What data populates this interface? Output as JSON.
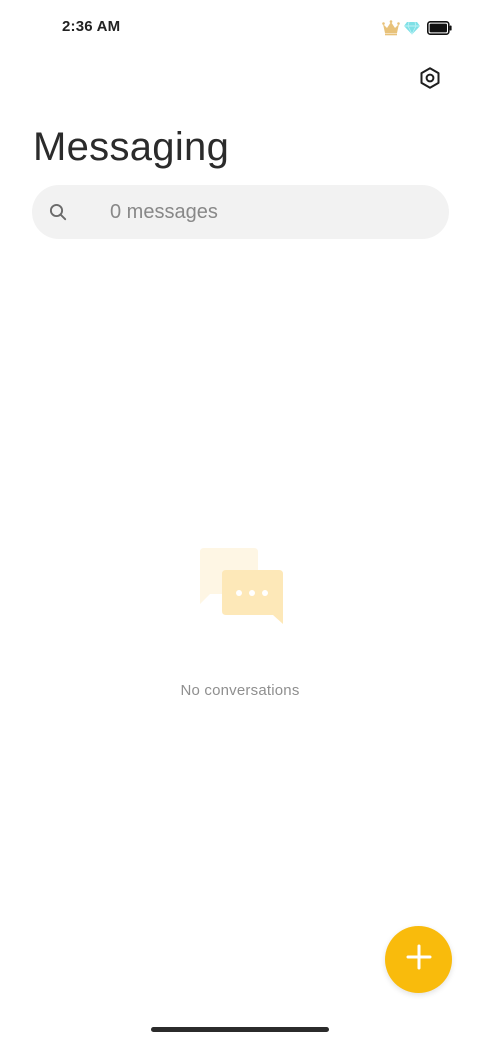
{
  "status_bar": {
    "time": "2:36 AM",
    "icons": [
      "crown-icon",
      "diamond-icon",
      "battery-icon"
    ]
  },
  "header": {
    "title": "Messaging",
    "settings_icon": "settings-hexagon-icon"
  },
  "search": {
    "placeholder": "0 messages",
    "value": "",
    "icon": "search-icon"
  },
  "empty_state": {
    "icon": "chat-bubbles-icon",
    "text": "No conversations"
  },
  "fab": {
    "icon": "plus-icon"
  },
  "colors": {
    "accent": "#f9bb0c",
    "illustration_back": "#fef6e4",
    "illustration_front": "#fde8b8",
    "search_bg": "#f2f2f2",
    "text_primary": "#2b2b2b",
    "text_secondary": "#8f8f8f"
  }
}
